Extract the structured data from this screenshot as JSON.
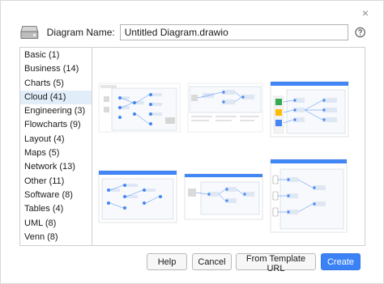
{
  "dialog": {
    "close_glyph": "×"
  },
  "header": {
    "disk_icon": "disk-icon",
    "name_label": "Diagram Name:",
    "name_value": "Untitled Diagram.drawio",
    "help_icon": "help-icon"
  },
  "sidebar": {
    "items": [
      {
        "label": "Basic (1)"
      },
      {
        "label": "Business (14)"
      },
      {
        "label": "Charts (5)"
      },
      {
        "label": "Cloud (41)"
      },
      {
        "label": "Engineering (3)"
      },
      {
        "label": "Flowcharts (9)"
      },
      {
        "label": "Layout (4)"
      },
      {
        "label": "Maps (5)"
      },
      {
        "label": "Network (13)"
      },
      {
        "label": "Other (11)"
      },
      {
        "label": "Software (8)"
      },
      {
        "label": "Tables (4)"
      },
      {
        "label": "UML (8)"
      },
      {
        "label": "Venn (8)"
      }
    ],
    "selected": "Cloud (41)"
  },
  "buttons": {
    "help": "Help",
    "cancel": "Cancel",
    "from_template_url": "From Template URL",
    "create": "Create"
  },
  "colors": {
    "accent": "#3b82f6",
    "selected_bg": "#e1edf9",
    "template_blue": "#4285f4"
  }
}
